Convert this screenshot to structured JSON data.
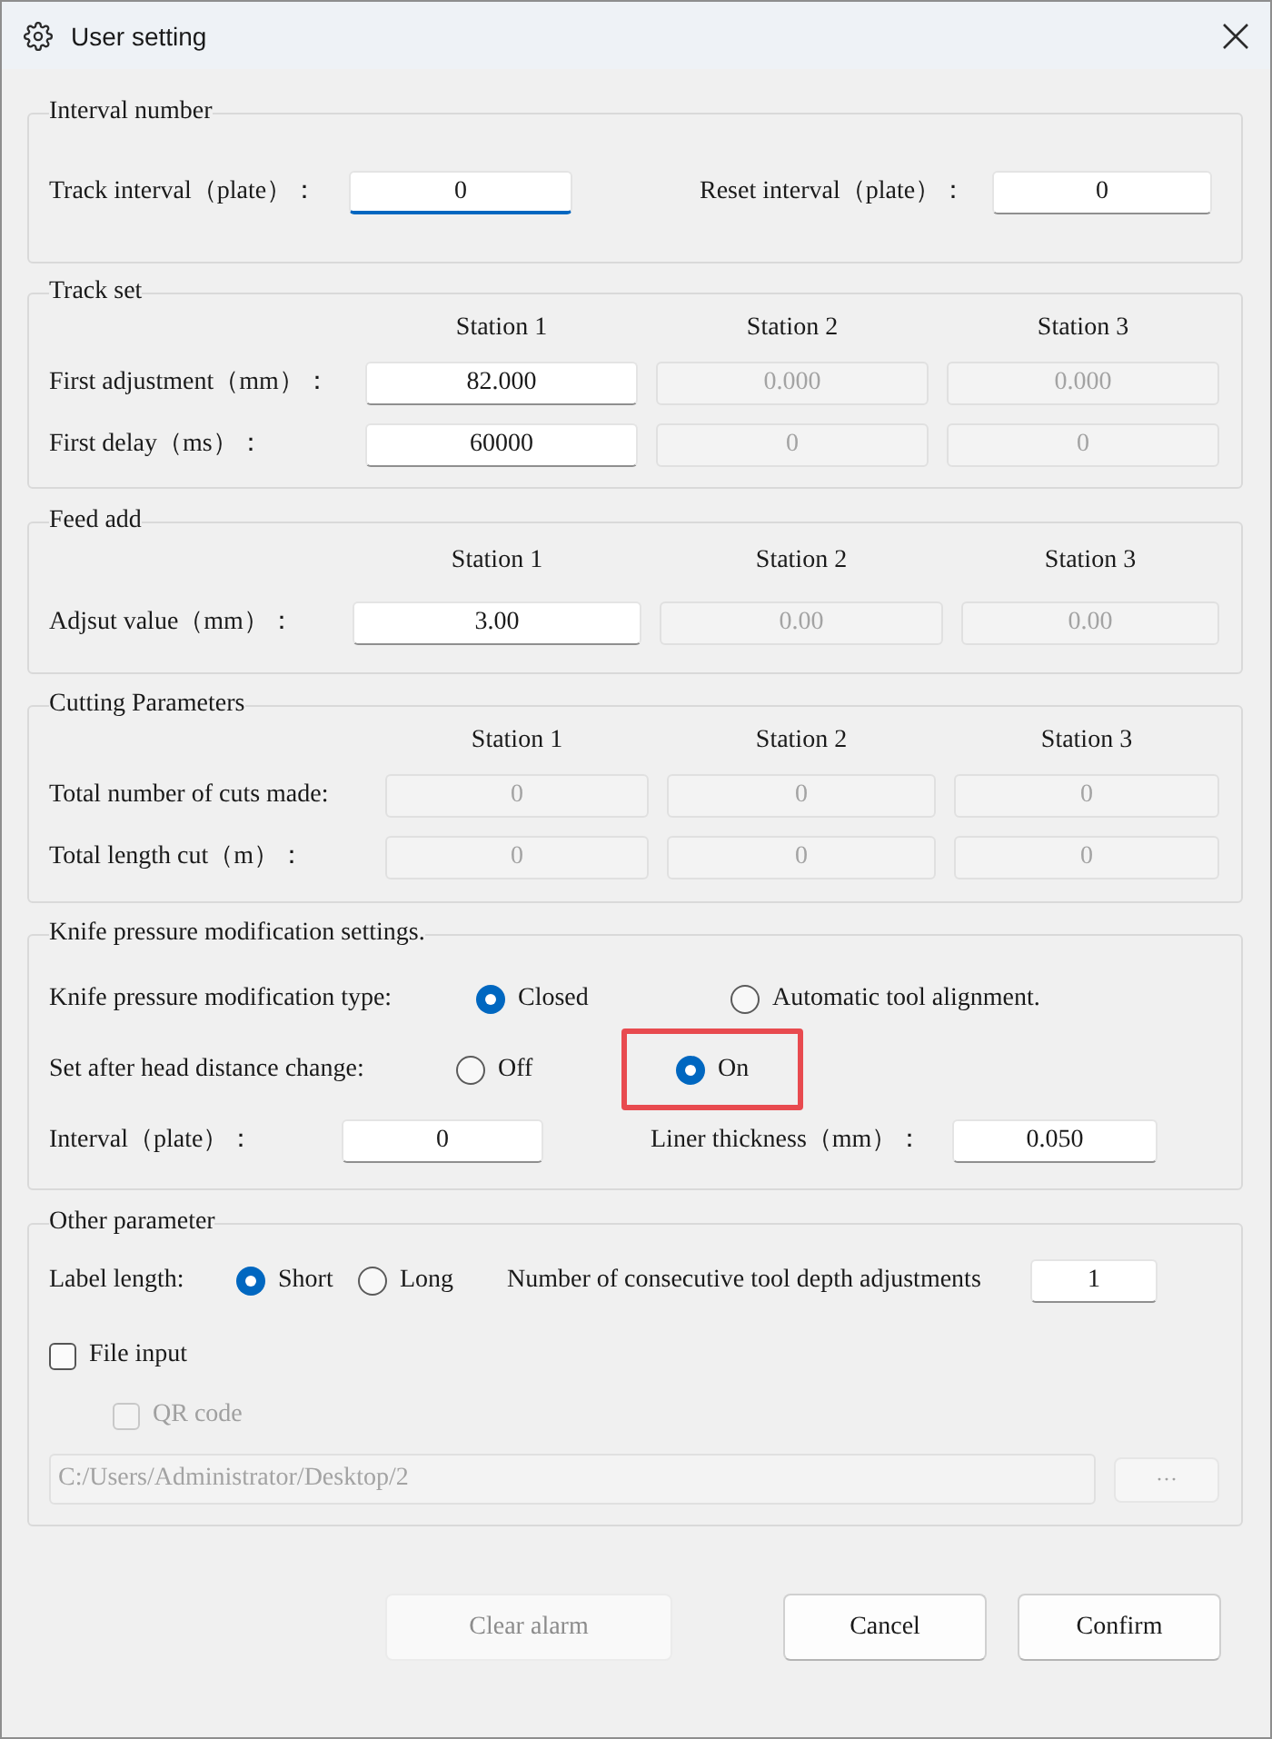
{
  "window": {
    "title": "User setting"
  },
  "sections": [
    {
      "kind": "pair_fields",
      "title": "Interval number",
      "fields": [
        {
          "label": "Track interval（plate）：",
          "value": "0",
          "focused": true
        },
        {
          "label": "Reset interval（plate）：",
          "value": "0",
          "focused": false
        }
      ]
    },
    {
      "kind": "station_grid",
      "title": "Track set",
      "columns": [
        "Station 1",
        "Station 2",
        "Station 3"
      ],
      "rows": [
        {
          "label": "First adjustment（mm）：",
          "cells": [
            {
              "value": "82.000",
              "disabled": false
            },
            {
              "value": "0.000",
              "disabled": true
            },
            {
              "value": "0.000",
              "disabled": true
            }
          ]
        },
        {
          "label": "First delay（ms）：",
          "cells": [
            {
              "value": "60000",
              "disabled": false
            },
            {
              "value": "0",
              "disabled": true
            },
            {
              "value": "0",
              "disabled": true
            }
          ]
        }
      ]
    },
    {
      "kind": "station_grid",
      "title": "Feed add",
      "columns": [
        "Station 1",
        "Station 2",
        "Station 3"
      ],
      "rows": [
        {
          "label": "Adjsut value（mm）：",
          "cells": [
            {
              "value": "3.00",
              "disabled": false
            },
            {
              "value": "0.00",
              "disabled": true
            },
            {
              "value": "0.00",
              "disabled": true
            }
          ]
        }
      ]
    },
    {
      "kind": "station_grid",
      "title": "Cutting Parameters",
      "columns": [
        "Station 1",
        "Station 2",
        "Station 3"
      ],
      "rows": [
        {
          "label": "Total number of cuts made:",
          "cells": [
            {
              "value": "0",
              "disabled": true
            },
            {
              "value": "0",
              "disabled": true
            },
            {
              "value": "0",
              "disabled": true
            }
          ]
        },
        {
          "label": "Total length cut（m）：",
          "cells": [
            {
              "value": "0",
              "disabled": true
            },
            {
              "value": "0",
              "disabled": true
            },
            {
              "value": "0",
              "disabled": true
            }
          ]
        }
      ]
    },
    {
      "kind": "radio_settings",
      "title": "Knife pressure modification settings.",
      "radio_rows": [
        {
          "label": "Knife pressure modification type:",
          "options": [
            {
              "label": "Closed",
              "selected": true,
              "highlighted": false
            },
            {
              "label": "Automatic tool alignment.",
              "selected": false,
              "highlighted": false
            }
          ]
        },
        {
          "label": "Set after head distance change:",
          "options": [
            {
              "label": "Off",
              "selected": false,
              "highlighted": false
            },
            {
              "label": "On",
              "selected": true,
              "highlighted": true
            }
          ]
        }
      ],
      "fields": [
        {
          "label": "Interval（plate）：",
          "value": "0"
        },
        {
          "label": "Liner thickness（mm）：",
          "value": "0.050"
        }
      ]
    },
    {
      "kind": "other",
      "title": "Other parameter",
      "label_length": {
        "label": "Label length:",
        "options": [
          {
            "label": "Short",
            "selected": true
          },
          {
            "label": "Long",
            "selected": false
          }
        ]
      },
      "depth_adjustments": {
        "label": "Number of consecutive tool depth adjustments",
        "value": "1"
      },
      "checkboxes": [
        {
          "label": "File input",
          "checked": false,
          "disabled": false
        },
        {
          "label": "QR code",
          "checked": false,
          "disabled": true
        }
      ],
      "path_field": {
        "value": "C:/Users/Administrator/Desktop/2",
        "disabled": true
      },
      "browse_button": {
        "label": "···",
        "disabled": true
      }
    }
  ],
  "buttons": [
    {
      "label": "Clear alarm",
      "disabled": true
    },
    {
      "label": "Cancel",
      "disabled": false
    },
    {
      "label": "Confirm",
      "disabled": false
    }
  ]
}
